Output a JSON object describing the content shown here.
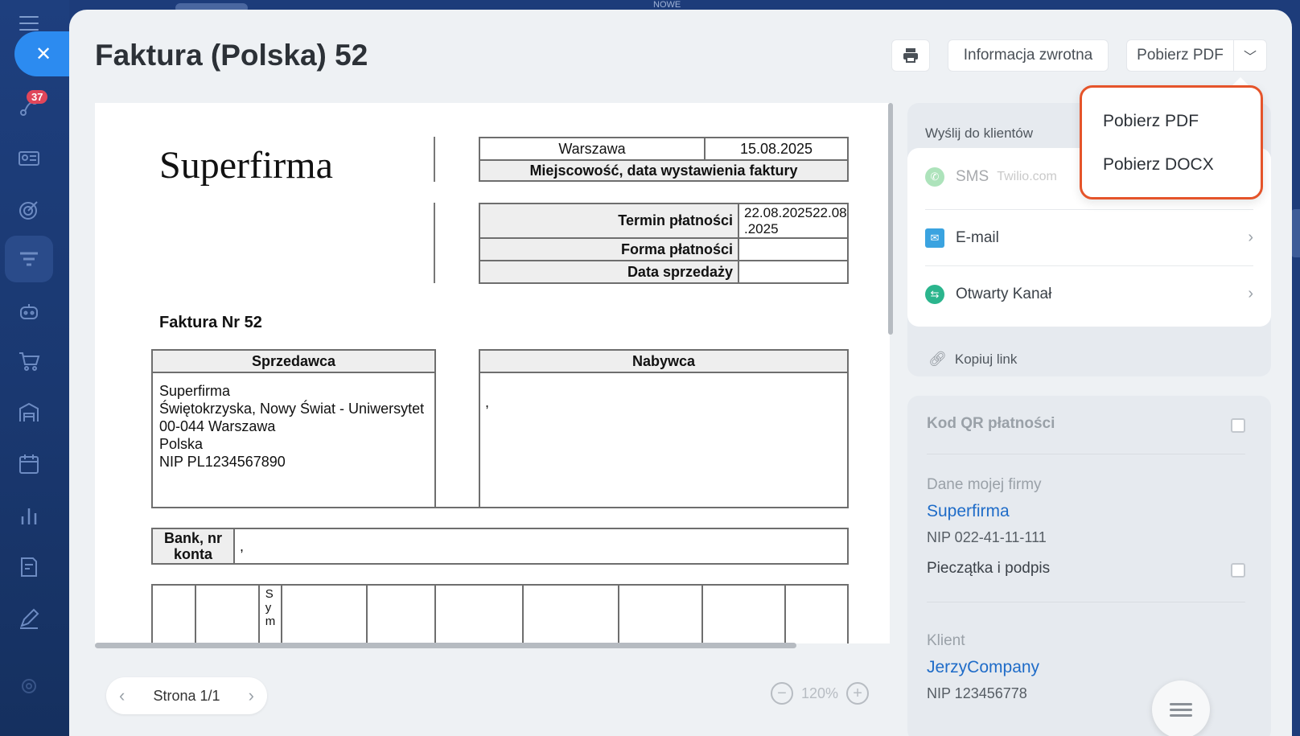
{
  "topbar": {
    "label": "NOWE"
  },
  "rail": {
    "badge_count": "37",
    "icons": [
      "menu-icon",
      "close-icon",
      "activity-icon",
      "contact-card-icon",
      "target-icon",
      "filter-icon",
      "robot-icon",
      "cart-icon",
      "warehouse-icon",
      "calendar-icon",
      "chart-icon",
      "document-sign-icon",
      "pen-icon"
    ]
  },
  "header": {
    "title": "Faktura (Polska) 52",
    "feedback_label": "Informacja zwrotna",
    "download_label": "Pobierz PDF"
  },
  "dropdown": {
    "items": [
      "Pobierz PDF",
      "Pobierz DOCX"
    ],
    "border_color": "#e5542a"
  },
  "document": {
    "company_logo": "Superfirma",
    "place": "Warszawa",
    "date": "15.08.2025",
    "place_date_label": "Miejscowość, data wystawienia faktury",
    "due_label": "Termin płatności",
    "due_value": "22.08.202522.08\n.2025",
    "payment_form_label": "Forma płatności",
    "sale_date_label": "Data sprzedaży",
    "invoice_number": "Faktura Nr 52",
    "seller_header": "Sprzedawca",
    "buyer_header": "Nabywca",
    "seller_details": "Superfirma\nŚwiętokrzyska, Nowy Świat - Uniwersytet\n00-044 Warszawa\nPolska\nNIP PL1234567890",
    "buyer_details": ",",
    "bank_label": "Bank, nr\nkonta",
    "bank_value": ",",
    "table_partial_header": "S\ny\nm"
  },
  "viewer": {
    "page_label": "Strona 1/1",
    "zoom": "120%"
  },
  "send": {
    "title": "Wyślij do klientów",
    "channels": [
      {
        "name": "SMS",
        "sub": "Twilio.com"
      },
      {
        "name": "E-mail"
      },
      {
        "name": "Otwarty Kanał"
      }
    ],
    "copy_link": "Kopiuj link"
  },
  "info": {
    "qr_label": "Kod QR płatności",
    "my_company_label": "Dane mojej firmy",
    "my_company_name": "Superfirma",
    "my_company_nip": "NIP 022-41-11-111",
    "stamp_label": "Pieczątka i podpis",
    "client_label": "Klient",
    "client_name": "JerzyCompany",
    "client_nip": "NIP 123456778"
  },
  "colors": {
    "accent": "#2c8bf0",
    "link": "#1f6cc8",
    "whatsapp": "#4cc36b",
    "email": "#3aa3e0",
    "openchannel": "#2bb58d"
  }
}
